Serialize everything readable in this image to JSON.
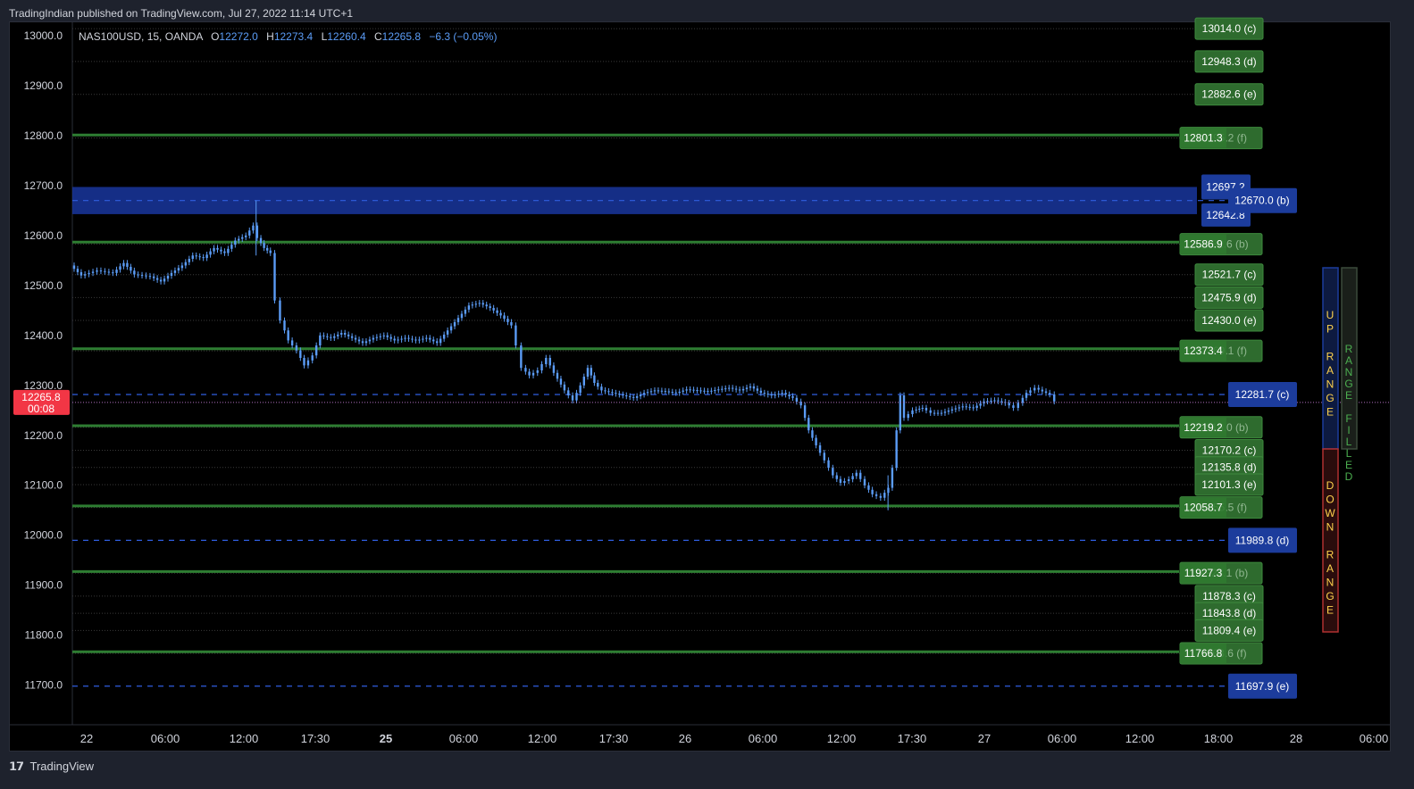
{
  "publish_line": "TradingIndian published on TradingView.com, Jul 27, 2022 11:14 UTC+1",
  "footer_brand": "TradingView",
  "legend": {
    "symbol": "NAS100USD, 15, OANDA",
    "o_label": "O",
    "o": "12272.0",
    "h_label": "H",
    "h": "12273.4",
    "l_label": "L",
    "l": "12260.4",
    "c_label": "C",
    "c": "12265.8",
    "change": "−6.3 (−0.05%)"
  },
  "colors": {
    "background": "#000000",
    "candle": "#5b9cf6",
    "green_line": "#2e7d32",
    "green_label": "#2e6b2e",
    "blue_zone": "#1a3aa8",
    "blue_label": "#1c3c9c",
    "price_label": "#f23645",
    "dashed_blue": "#2f5ee0",
    "up_range": "#ffd24d",
    "down_range": "#ffd24d",
    "range_filled": "#4caf50"
  },
  "chart_data": {
    "type": "candlestick",
    "title": "",
    "y_ticks": [
      "13000.0",
      "12900.0",
      "12800.0",
      "12700.0",
      "12600.0",
      "12500.0",
      "12400.0",
      "12300.0",
      "12200.0",
      "12100.0",
      "12000.0",
      "11900.0",
      "11800.0",
      "11700.0"
    ],
    "y_range": [
      11628,
      13050
    ],
    "x_ticks": [
      "22",
      "06:00",
      "12:00",
      "17:30",
      "25",
      "06:00",
      "12:00",
      "17:30",
      "26",
      "06:00",
      "12:00",
      "17:30",
      "27",
      "06:00",
      "12:00",
      "18:00",
      "28",
      "06:00"
    ],
    "bold_x_ticks": [
      "25"
    ],
    "x_range": [
      0,
      100
    ],
    "current_price": {
      "price": "12265.8",
      "countdown": "00:08",
      "value": 12265.8
    },
    "price_path": [
      [
        0,
        12540
      ],
      [
        1,
        12520
      ],
      [
        2.5,
        12530
      ],
      [
        4,
        12525
      ],
      [
        5,
        12545
      ],
      [
        6,
        12522
      ],
      [
        7.5,
        12518
      ],
      [
        8.5,
        12508
      ],
      [
        9.5,
        12525
      ],
      [
        10.5,
        12540
      ],
      [
        11.5,
        12560
      ],
      [
        12.5,
        12555
      ],
      [
        13.5,
        12575
      ],
      [
        14.5,
        12565
      ],
      [
        15.5,
        12590
      ],
      [
        16.5,
        12600
      ],
      [
        17.2,
        12620
      ],
      [
        17.6,
        12595
      ],
      [
        18.2,
        12575
      ],
      [
        18.8,
        12565
      ],
      [
        19.3,
        12470
      ],
      [
        19.8,
        12430
      ],
      [
        20.5,
        12390
      ],
      [
        21.3,
        12370
      ],
      [
        22,
        12340
      ],
      [
        22.8,
        12360
      ],
      [
        23.5,
        12400
      ],
      [
        24.5,
        12395
      ],
      [
        25.5,
        12405
      ],
      [
        26.5,
        12395
      ],
      [
        27.5,
        12385
      ],
      [
        28.5,
        12395
      ],
      [
        29.5,
        12400
      ],
      [
        30.5,
        12390
      ],
      [
        31.5,
        12395
      ],
      [
        32.5,
        12390
      ],
      [
        33.5,
        12395
      ],
      [
        34.5,
        12385
      ],
      [
        35.5,
        12410
      ],
      [
        36.5,
        12435
      ],
      [
        37.5,
        12460
      ],
      [
        38.5,
        12465
      ],
      [
        39.5,
        12455
      ],
      [
        40.5,
        12440
      ],
      [
        41.5,
        12420
      ],
      [
        42,
        12380
      ],
      [
        42.5,
        12335
      ],
      [
        43.2,
        12320
      ],
      [
        44,
        12330
      ],
      [
        44.8,
        12355
      ],
      [
        45.5,
        12325
      ],
      [
        46.5,
        12290
      ],
      [
        47.3,
        12270
      ],
      [
        48,
        12300
      ],
      [
        48.7,
        12335
      ],
      [
        49.3,
        12305
      ],
      [
        50,
        12290
      ],
      [
        51,
        12285
      ],
      [
        52,
        12280
      ],
      [
        53,
        12275
      ],
      [
        54,
        12285
      ],
      [
        55,
        12290
      ],
      [
        56,
        12288
      ],
      [
        57,
        12285
      ],
      [
        58,
        12292
      ],
      [
        59,
        12290
      ],
      [
        60,
        12288
      ],
      [
        61,
        12292
      ],
      [
        62,
        12295
      ],
      [
        63,
        12290
      ],
      [
        64,
        12298
      ],
      [
        65,
        12285
      ],
      [
        66,
        12280
      ],
      [
        67,
        12285
      ],
      [
        68,
        12275
      ],
      [
        68.8,
        12260
      ],
      [
        69.5,
        12210
      ],
      [
        70.2,
        12180
      ],
      [
        71,
        12150
      ],
      [
        71.8,
        12120
      ],
      [
        72.5,
        12105
      ],
      [
        73.3,
        12112
      ],
      [
        74,
        12125
      ],
      [
        74.8,
        12100
      ],
      [
        75.5,
        12082
      ],
      [
        76.3,
        12075
      ],
      [
        77,
        12095
      ],
      [
        77.4,
        12135
      ],
      [
        77.8,
        12210
      ],
      [
        78.1,
        12280
      ],
      [
        78.5,
        12235
      ],
      [
        79.3,
        12250
      ],
      [
        80.2,
        12255
      ],
      [
        81,
        12245
      ],
      [
        82,
        12245
      ],
      [
        83,
        12252
      ],
      [
        84,
        12258
      ],
      [
        85,
        12255
      ],
      [
        86,
        12268
      ],
      [
        87,
        12270
      ],
      [
        88,
        12265
      ],
      [
        88.8,
        12255
      ],
      [
        89.3,
        12265
      ],
      [
        90,
        12285
      ],
      [
        90.8,
        12295
      ],
      [
        91.5,
        12288
      ],
      [
        92.2,
        12282
      ],
      [
        92.7,
        12268
      ]
    ],
    "green_levels": [
      12801.3,
      12586.9,
      12373.4,
      12219.2,
      12058.7,
      11927.3,
      11766.8
    ],
    "dashed_levels": [
      {
        "value": 12670.0,
        "label": "12670.0 (b)"
      },
      {
        "value": 12281.7,
        "label": "12281.7 (c)"
      },
      {
        "value": 11989.8,
        "label": "11989.8 (d)"
      },
      {
        "value": 11697.9,
        "label": "11697.9 (e)"
      }
    ],
    "blue_zone": {
      "top": 12697.2,
      "bottom": 12642.8,
      "top_label": "12697.2",
      "bottom_label": "12642.8"
    },
    "right_labels": [
      {
        "value": 13014.0,
        "text": "13014.0 (c)"
      },
      {
        "value": 12948.3,
        "text": "12948.3 (d)"
      },
      {
        "value": 12882.6,
        "text": "12882.6 (e)"
      },
      {
        "value": 12795.2,
        "text": "12801.3",
        "under": "12795.2 (f)"
      },
      {
        "value": 12582.6,
        "text": "12586.9",
        "under": "12582.6 (b)"
      },
      {
        "value": 12521.7,
        "text": "12521.7 (c)"
      },
      {
        "value": 12475.9,
        "text": "12475.9 (d)"
      },
      {
        "value": 12430.0,
        "text": "12430.0 (e)"
      },
      {
        "value": 12369.1,
        "text": "12373.4",
        "under": "12369.1 (f)"
      },
      {
        "value": 12216.0,
        "text": "12219.2",
        "under": "12216.0 (b)"
      },
      {
        "value": 12170.2,
        "text": "12170.2 (c)"
      },
      {
        "value": 12135.8,
        "text": "12135.8 (d)"
      },
      {
        "value": 12101.3,
        "text": "12101.3 (e)"
      },
      {
        "value": 12055.5,
        "text": "12058.7",
        "under": "12055.5 (f)"
      },
      {
        "value": 11924.1,
        "text": "11927.3",
        "under": "11924.1 (b)"
      },
      {
        "value": 11878.3,
        "text": "11878.3 (c)"
      },
      {
        "value": 11843.8,
        "text": "11843.8 (d)"
      },
      {
        "value": 11809.4,
        "text": "11809.4 (e)"
      },
      {
        "value": 11763.6,
        "text": "11766.8",
        "under": "11763.6 (f)"
      }
    ],
    "range_boxes": {
      "up": [
        "U",
        "P",
        "",
        "R",
        "A",
        "N",
        "G",
        "E"
      ],
      "down": [
        "D",
        "O",
        "W",
        "N",
        "",
        "R",
        "A",
        "N",
        "G",
        "E"
      ],
      "filled": [
        "R",
        "A",
        "N",
        "G",
        "E",
        "",
        "F",
        "I",
        "L",
        "L",
        "E",
        "D"
      ]
    }
  }
}
